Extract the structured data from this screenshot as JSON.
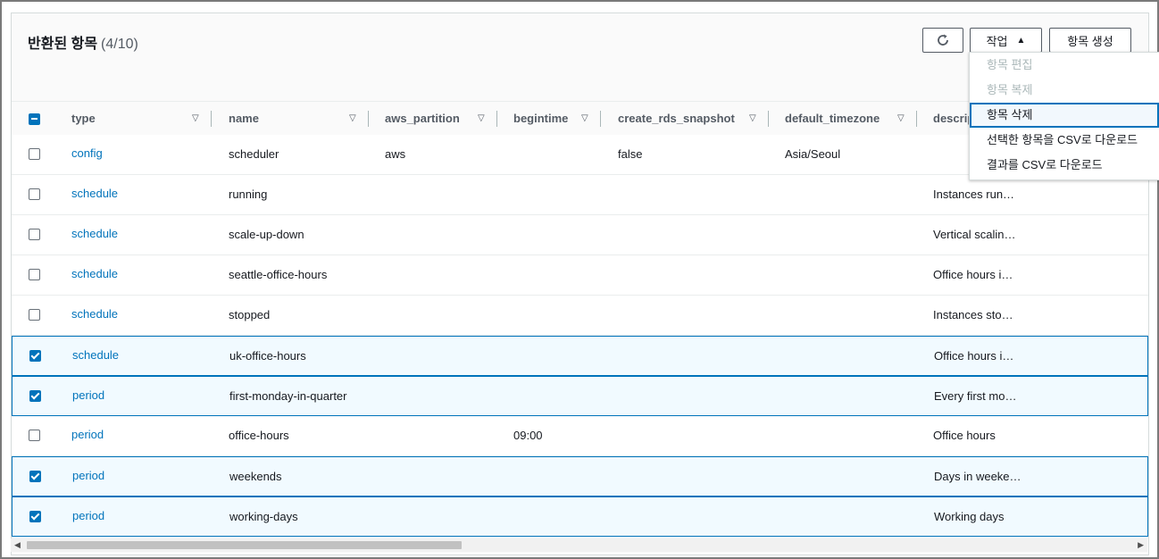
{
  "header": {
    "title": "반환된 항목",
    "count": "(4/10)",
    "refresh_icon": "refresh-icon",
    "actions_label": "작업",
    "actions_caret": "▲",
    "create_label": "항목 생성"
  },
  "menu": {
    "items": [
      {
        "label": "항목 편집",
        "disabled": true
      },
      {
        "label": "항목 복제",
        "disabled": true
      },
      {
        "label": "항목 삭제",
        "disabled": false
      },
      {
        "label": "선택한 항목을 CSV로 다운로드",
        "disabled": false
      },
      {
        "label": "결과를 CSV로 다운로드",
        "disabled": false
      }
    ]
  },
  "table": {
    "columns": [
      "type",
      "name",
      "aws_partition",
      "begintime",
      "create_rds_snapshot",
      "default_timezone",
      "descrip"
    ],
    "rows": [
      {
        "selected": false,
        "type": "config",
        "name": "scheduler",
        "aws_partition": "aws",
        "begintime": "",
        "create_rds_snapshot": "false",
        "default_timezone": "Asia/Seoul",
        "description": ""
      },
      {
        "selected": false,
        "type": "schedule",
        "name": "running",
        "aws_partition": "",
        "begintime": "",
        "create_rds_snapshot": "",
        "default_timezone": "",
        "description": "Instances run…"
      },
      {
        "selected": false,
        "type": "schedule",
        "name": "scale-up-down",
        "aws_partition": "",
        "begintime": "",
        "create_rds_snapshot": "",
        "default_timezone": "",
        "description": "Vertical scalin…"
      },
      {
        "selected": false,
        "type": "schedule",
        "name": "seattle-office-hours",
        "aws_partition": "",
        "begintime": "",
        "create_rds_snapshot": "",
        "default_timezone": "",
        "description": "Office hours i…"
      },
      {
        "selected": false,
        "type": "schedule",
        "name": "stopped",
        "aws_partition": "",
        "begintime": "",
        "create_rds_snapshot": "",
        "default_timezone": "",
        "description": "Instances sto…"
      },
      {
        "selected": true,
        "type": "schedule",
        "name": "uk-office-hours",
        "aws_partition": "",
        "begintime": "",
        "create_rds_snapshot": "",
        "default_timezone": "",
        "description": "Office hours i…"
      },
      {
        "selected": true,
        "type": "period",
        "name": "first-monday-in-quarter",
        "aws_partition": "",
        "begintime": "",
        "create_rds_snapshot": "",
        "default_timezone": "",
        "description": "Every first mo…"
      },
      {
        "selected": false,
        "type": "period",
        "name": "office-hours",
        "aws_partition": "",
        "begintime": "09:00",
        "create_rds_snapshot": "",
        "default_timezone": "",
        "description": "Office hours"
      },
      {
        "selected": true,
        "type": "period",
        "name": "weekends",
        "aws_partition": "",
        "begintime": "",
        "create_rds_snapshot": "",
        "default_timezone": "",
        "description": "Days in weeke…"
      },
      {
        "selected": true,
        "type": "period",
        "name": "working-days",
        "aws_partition": "",
        "begintime": "",
        "create_rds_snapshot": "",
        "default_timezone": "",
        "description": "Working days"
      }
    ]
  },
  "colors": {
    "accent": "#0073bb",
    "selected_row": "#f1faff",
    "muted": "#aab7b8"
  }
}
